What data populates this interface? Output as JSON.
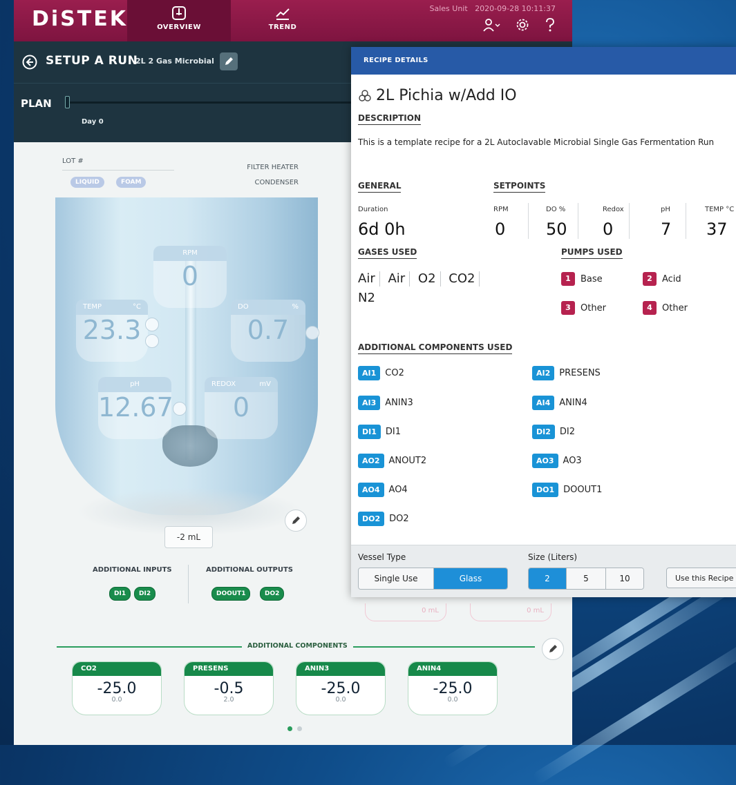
{
  "colors": {
    "brand": "#8a1845",
    "accent": "#1e8fd8",
    "pump": "#b6224f",
    "component": "#17894a"
  },
  "app": {
    "logo": "DiSTEK",
    "nav": [
      {
        "label": "OVERVIEW",
        "icon": "reactor-icon"
      },
      {
        "label": "TREND",
        "icon": "trend-icon"
      }
    ],
    "unit": "Sales Unit",
    "datetime": "2020-09-28 10:11:37"
  },
  "setup": {
    "title": "SETUP A RUN",
    "subtitle": "2L 2 Gas Microbial"
  },
  "plan": {
    "label": "PLAN",
    "day": "Day 0"
  },
  "vessel": {
    "lot_label": "LOT #",
    "liquid": "LIQUID",
    "foam": "FOAM",
    "filter_heater": "FILTER HEATER",
    "condenser": "CONDENSER",
    "rpm": {
      "label": "RPM",
      "value": "0"
    },
    "temp": {
      "label": "TEMP",
      "unit": "°C",
      "value": "23.3"
    },
    "do": {
      "label": "DO",
      "unit": "%",
      "value": "0.7"
    },
    "ph": {
      "label": "pH",
      "value": "12.67"
    },
    "redox": {
      "label": "REDOX",
      "unit": "mV",
      "value": "0"
    },
    "volume": "-2 mL"
  },
  "io": {
    "inputs_label": "ADDITIONAL INPUTS",
    "outputs_label": "ADDITIONAL OUTPUTS",
    "inputs": [
      "DI1",
      "DI2"
    ],
    "outputs": [
      "DOOUT1",
      "DO2"
    ],
    "pump_ghost_1": "0 mL",
    "pump_ghost_2": "0 mL"
  },
  "components": {
    "label": "ADDITIONAL COMPONENTS",
    "items": [
      {
        "name": "CO2",
        "value": "-25.0",
        "sub": "0.0"
      },
      {
        "name": "PRESENS",
        "value": "-0.5",
        "sub": "2.0"
      },
      {
        "name": "ANIN3",
        "value": "-25.0",
        "sub": "0.0"
      },
      {
        "name": "ANIN4",
        "value": "-25.0",
        "sub": "0.0"
      }
    ]
  },
  "recipe": {
    "header": "RECIPE DETAILS",
    "title": "2L Pichia w/Add IO",
    "description_label": "DESCRIPTION",
    "description": "This is a template recipe for a 2L Autoclavable Microbial Single Gas Fermentation Run",
    "general_label": "GENERAL",
    "setpoints_label": "SETPOINTS",
    "duration_label": "Duration",
    "duration": "6d 0h",
    "setpoints": [
      {
        "label": "RPM",
        "value": "0"
      },
      {
        "label": "DO %",
        "value": "50"
      },
      {
        "label": "Redox",
        "value": "0"
      },
      {
        "label": "pH",
        "value": "7"
      },
      {
        "label": "TEMP °C",
        "value": "37"
      }
    ],
    "gases_label": "GASES USED",
    "gases": [
      "Air",
      "Air",
      "O2",
      "CO2",
      "N2"
    ],
    "pumps_label": "PUMPS USED",
    "pumps": [
      {
        "num": "1",
        "name": "Base"
      },
      {
        "num": "2",
        "name": "Acid"
      },
      {
        "num": "3",
        "name": "Other"
      },
      {
        "num": "4",
        "name": "Other"
      }
    ],
    "components_label": "ADDITIONAL COMPONENTS USED",
    "components": [
      {
        "tag": "AI1",
        "name": "CO2"
      },
      {
        "tag": "AI2",
        "name": "PRESENS"
      },
      {
        "tag": "AI3",
        "name": "ANIN3"
      },
      {
        "tag": "AI4",
        "name": "ANIN4"
      },
      {
        "tag": "DI1",
        "name": "DI1"
      },
      {
        "tag": "DI2",
        "name": "DI2"
      },
      {
        "tag": "AO2",
        "name": "ANOUT2"
      },
      {
        "tag": "AO3",
        "name": "AO3"
      },
      {
        "tag": "AO4",
        "name": "AO4"
      },
      {
        "tag": "DO1",
        "name": "DOOUT1"
      },
      {
        "tag": "DO2",
        "name": "DO2"
      }
    ],
    "vessel_type_label": "Vessel Type",
    "vessel_types": [
      "Single Use",
      "Glass"
    ],
    "vessel_type_selected": "Glass",
    "size_label": "Size (Liters)",
    "sizes": [
      "2",
      "5",
      "10"
    ],
    "size_selected": "2",
    "use_button": "Use this Recipe"
  }
}
